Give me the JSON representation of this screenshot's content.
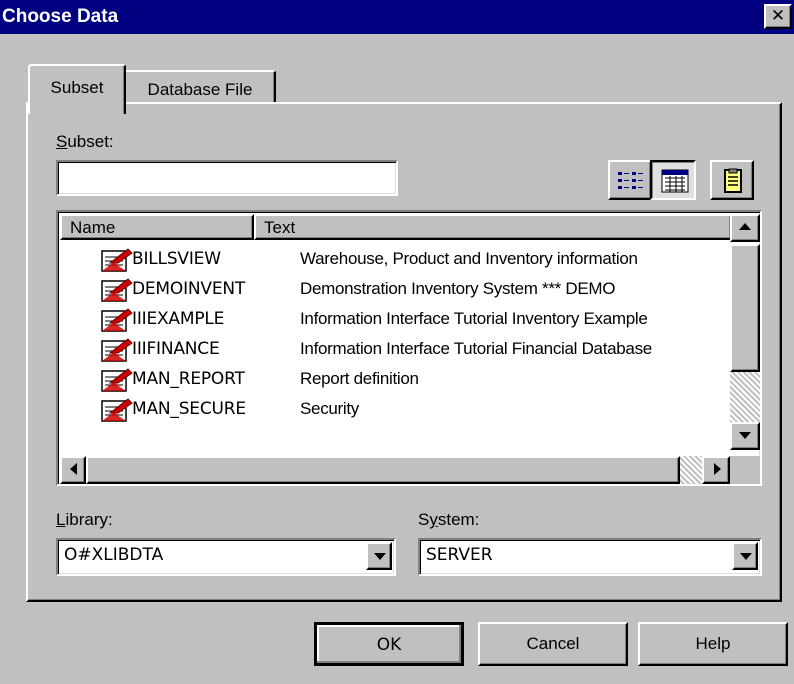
{
  "window": {
    "title": "Choose Data",
    "close_glyph": "✕"
  },
  "tabs": [
    {
      "label": "Subset",
      "selected": true
    },
    {
      "label": "Database File",
      "selected": false
    }
  ],
  "subset": {
    "label_mnemonic": "S",
    "label_rest": "ubset:",
    "value": ""
  },
  "view_buttons": [
    {
      "name": "list-view-icon",
      "pressed": false
    },
    {
      "name": "details-view-icon",
      "pressed": true
    },
    {
      "name": "clipboard-icon",
      "pressed": false
    }
  ],
  "list": {
    "columns": [
      "Name",
      "Text"
    ],
    "rows": [
      {
        "name": "BILLSVIEW",
        "text": "Warehouse, Product and Inventory information"
      },
      {
        "name": "DEMOINVENT",
        "text": "Demonstration Inventory System    *** DEMO"
      },
      {
        "name": "IIIEXAMPLE",
        "text": "Information Interface Tutorial Inventory Example"
      },
      {
        "name": "IIIFINANCE",
        "text": "Information Interface Tutorial Financial Database"
      },
      {
        "name": "MAN_REPORT",
        "text": "Report definition"
      },
      {
        "name": "MAN_SECURE",
        "text": "Security"
      }
    ],
    "row_icon": "database-file-icon"
  },
  "library": {
    "label_mnemonic": "L",
    "label_rest": "ibrary:",
    "value": "O#XLIBDTA"
  },
  "system": {
    "label_pre": "S",
    "label_mnemonic": "y",
    "label_rest": "stem:",
    "value": "SERVER"
  },
  "buttons": {
    "ok": "OK",
    "cancel": "Cancel",
    "help": "Help"
  },
  "colors": {
    "titlebar": "#000080",
    "face": "#c0c0c0",
    "icon_red": "#d00000"
  }
}
